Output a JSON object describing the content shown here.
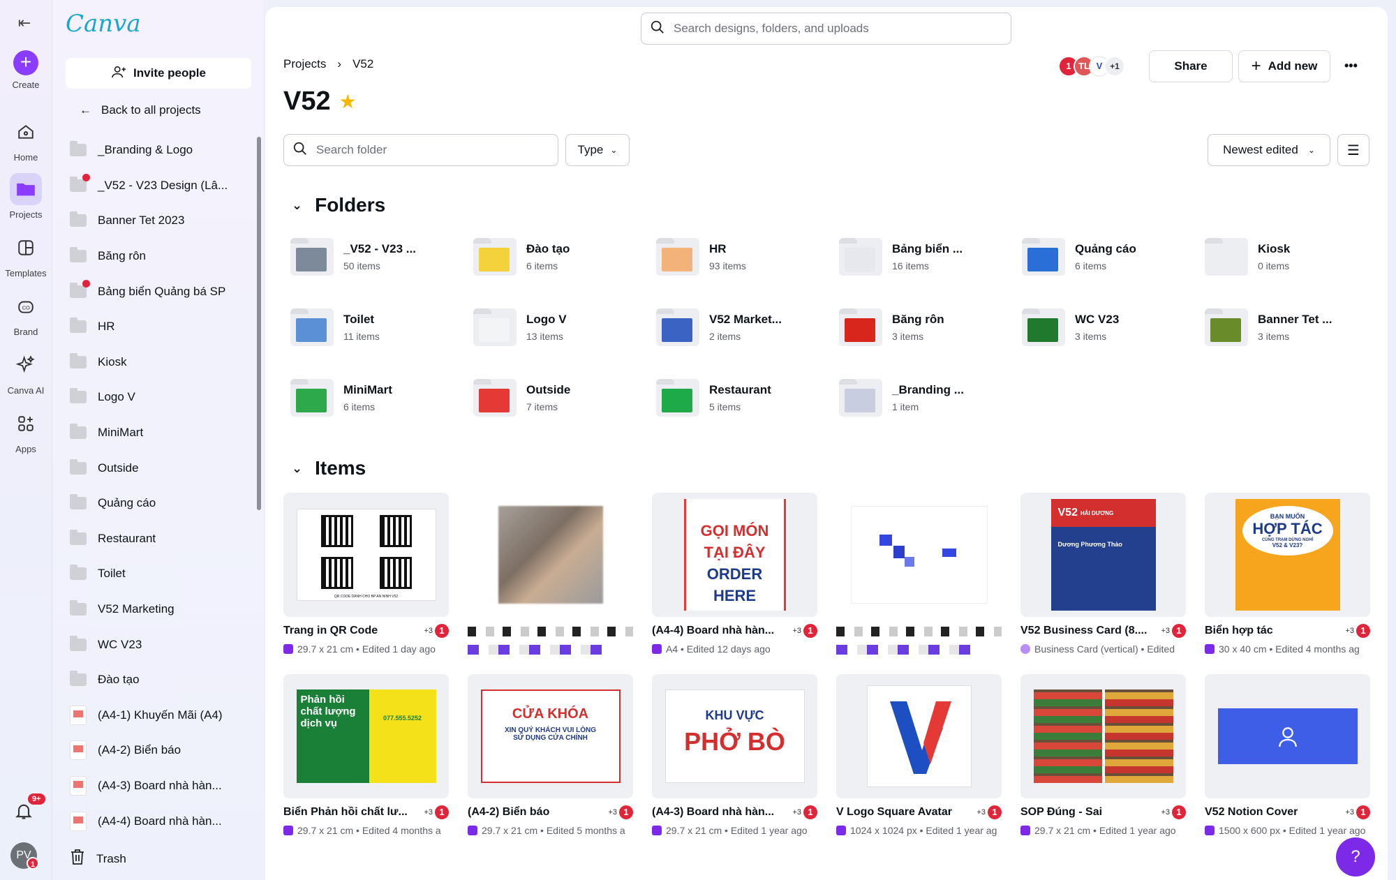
{
  "rail": {
    "create": "Create",
    "items": [
      {
        "label": "Home",
        "icon": "home-icon"
      },
      {
        "label": "Projects",
        "icon": "folder-icon"
      },
      {
        "label": "Templates",
        "icon": "templates-icon"
      },
      {
        "label": "Brand",
        "icon": "brand-icon"
      },
      {
        "label": "Canva AI",
        "icon": "sparkle-icon"
      },
      {
        "label": "Apps",
        "icon": "apps-icon"
      }
    ],
    "notifications_badge": "9+",
    "avatar_initials": "PV",
    "avatar_badge": "1"
  },
  "sidebar": {
    "logo": "Canva",
    "invite": "Invite people",
    "back": "Back to all projects",
    "projects": [
      {
        "label": "_Branding & Logo",
        "kind": "folder"
      },
      {
        "label": "_V52 - V23 Design (Lâ...",
        "kind": "folder",
        "dot": true
      },
      {
        "label": "Banner Tet 2023",
        "kind": "folder"
      },
      {
        "label": "Băng rôn",
        "kind": "folder"
      },
      {
        "label": "Bảng biển Quảng bá SP",
        "kind": "folder",
        "dot": true
      },
      {
        "label": "HR",
        "kind": "folder"
      },
      {
        "label": "Kiosk",
        "kind": "folder"
      },
      {
        "label": "Logo V",
        "kind": "folder"
      },
      {
        "label": "MiniMart",
        "kind": "folder"
      },
      {
        "label": "Outside",
        "kind": "folder"
      },
      {
        "label": "Quảng cáo",
        "kind": "folder"
      },
      {
        "label": "Restaurant",
        "kind": "folder"
      },
      {
        "label": "Toilet",
        "kind": "folder"
      },
      {
        "label": "V52 Marketing",
        "kind": "folder"
      },
      {
        "label": "WC V23",
        "kind": "folder"
      },
      {
        "label": "Đào tạo",
        "kind": "folder"
      },
      {
        "label": "(A4-1) Khuyến Mãi (A4)",
        "kind": "doc"
      },
      {
        "label": "(A4-2) Biển báo",
        "kind": "doc"
      },
      {
        "label": "(A4-3) Board nhà hàn...",
        "kind": "doc"
      },
      {
        "label": "(A4-4) Board nhà hàn...",
        "kind": "doc"
      }
    ],
    "trash": "Trash"
  },
  "header": {
    "search_placeholder": "Search designs, folders, and uploads",
    "breadcrumb": [
      "Projects",
      "V52"
    ],
    "title": "V52",
    "collab_extra": "+1",
    "share": "Share",
    "add_new": "Add new",
    "more": "•••"
  },
  "toolbar": {
    "folder_search_placeholder": "Search folder",
    "type": "Type",
    "sort": "Newest edited"
  },
  "folders_heading": "Folders",
  "items_heading": "Items",
  "folders": [
    {
      "name": "_V52 - V23 ...",
      "count": "50 items",
      "color": "#7d8a99"
    },
    {
      "name": "Đào tạo",
      "count": "6 items",
      "color": "#f4d23c"
    },
    {
      "name": "HR",
      "count": "93 items",
      "color": "#f2b27a"
    },
    {
      "name": "Bảng biển ...",
      "count": "16 items",
      "color": "#e6e8ee"
    },
    {
      "name": "Quảng cáo",
      "count": "6 items",
      "color": "#2a6fd8"
    },
    {
      "name": "Kiosk",
      "count": "0 items",
      "color": "#eceef1"
    },
    {
      "name": "Toilet",
      "count": "11 items",
      "color": "#5b8fd6"
    },
    {
      "name": "Logo V",
      "count": "13 items",
      "color": "#f3f4f6"
    },
    {
      "name": "V52 Market...",
      "count": "2 items",
      "color": "#3b63c4"
    },
    {
      "name": "Băng rôn",
      "count": "3 items",
      "color": "#d9261c"
    },
    {
      "name": "WC V23",
      "count": "3 items",
      "color": "#1f7a2e"
    },
    {
      "name": "Banner Tet ...",
      "count": "3 items",
      "color": "#6a8b2a"
    },
    {
      "name": "MiniMart",
      "count": "6 items",
      "color": "#2da84a"
    },
    {
      "name": "Outside",
      "count": "7 items",
      "color": "#e53935"
    },
    {
      "name": "Restaurant",
      "count": "5 items",
      "color": "#1faa4a"
    },
    {
      "name": "_Branding ...",
      "count": "1 item",
      "color": "#c8cde0"
    }
  ],
  "items": [
    {
      "name": "Trang in QR Code",
      "meta": "29.7 x 21 cm • Edited 1 day ago",
      "av": "+3",
      "kind": "qr"
    },
    {
      "name": "",
      "meta": "",
      "av": "",
      "kind": "blurred-photo"
    },
    {
      "name": "(A4-4) Board nhà hàn...",
      "meta": "A4 • Edited 12 days ago",
      "av": "+3",
      "kind": "order"
    },
    {
      "name": "",
      "meta": "",
      "av": "",
      "kind": "blurred-blue"
    },
    {
      "name": "V52 Business Card (8....",
      "meta": "Business Card (vertical) • Edited",
      "av": "+3",
      "kind": "bcard"
    },
    {
      "name": "Biển hợp tác",
      "meta": "30 x 40 cm • Edited 4 months ag",
      "av": "+3",
      "kind": "poster"
    },
    {
      "name": "Biển Phản hồi chất lư...",
      "meta": "29.7 x 21 cm • Edited 4 months a",
      "av": "+3",
      "kind": "feedback"
    },
    {
      "name": "(A4-2) Biển báo",
      "meta": "29.7 x 21 cm • Edited 5 months a",
      "av": "+3",
      "kind": "door"
    },
    {
      "name": "(A4-3) Board nhà hàn...",
      "meta": "29.7 x 21 cm • Edited 1 year ago",
      "av": "+3",
      "kind": "pho"
    },
    {
      "name": "V Logo Square Avatar",
      "meta": "1024 x 1024 px • Edited 1 year ag",
      "av": "+3",
      "kind": "vlogo"
    },
    {
      "name": "SOP Đúng - Sai",
      "meta": "29.7 x 21 cm • Edited 1 year ago",
      "av": "+3",
      "kind": "shelves"
    },
    {
      "name": "V52 Notion Cover",
      "meta": "1500 x 600 px • Edited 1 year ago",
      "av": "+3",
      "kind": "notion"
    }
  ],
  "thumb_text": {
    "order": [
      "GỌI MÓN",
      "TẠI ĐÂY",
      "ORDER",
      "HERE"
    ],
    "door": [
      "CỬA KHÓA",
      "XIN QUÝ KHÁCH VUI LÒNG",
      "SỬ DỤNG CỬA CHÍNH"
    ],
    "pho": [
      "KHU VỰC",
      "PHỞ BÒ"
    ],
    "poster": [
      "BẠN MUỐN",
      "HỢP TÁC",
      "CÙNG TRẠM DỪNG NGHỈ",
      "V52 & V23?"
    ],
    "feedback": [
      "Phản hồi",
      "chất lượng",
      "dịch vụ",
      "077.555.5252"
    ],
    "bcard": [
      "V52",
      "HẢI DƯƠNG",
      "Dương Phương Thảo"
    ],
    "qr_caption": "QR CODE DÀNH CHO BP AN NINH V52"
  },
  "colors": {
    "accent": "#8b3dff",
    "alert": "#e0243a"
  }
}
